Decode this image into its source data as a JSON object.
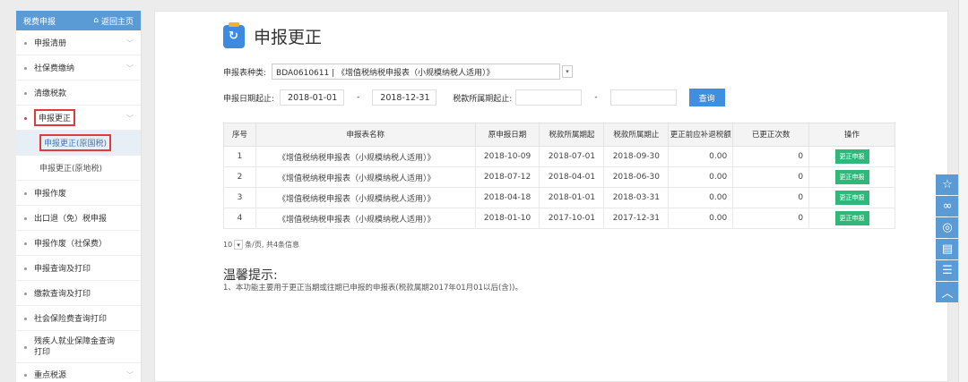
{
  "sidebar": {
    "header_title": "税费申报",
    "home_label": "返回主页",
    "items": [
      {
        "label": "申报清册",
        "chevron": true
      },
      {
        "label": "社保费缴纳",
        "chevron": true
      },
      {
        "label": "清缴税款",
        "chevron": false
      },
      {
        "label": "申报更正",
        "chevron": true,
        "active": true
      },
      {
        "label": "申报作废",
        "chevron": false
      },
      {
        "label": "出口退（免）税申报",
        "chevron": false
      },
      {
        "label": "申报作废（社保费）",
        "chevron": false
      },
      {
        "label": "申报查询及打印",
        "chevron": false
      },
      {
        "label": "缴款查询及打印",
        "chevron": false
      },
      {
        "label": "社会保险费查询打印",
        "chevron": false
      },
      {
        "label": "残疾人就业保障金查询打印",
        "chevron": false
      },
      {
        "label": "重点税源",
        "chevron": true
      }
    ],
    "sub_items": [
      {
        "label": "申报更正(原国税)",
        "selected": true
      },
      {
        "label": "申报更正(原地税)",
        "selected": false
      }
    ]
  },
  "main": {
    "title": "申报更正",
    "form": {
      "type_label": "申报表种类:",
      "type_value": "BDA0610611 | 《增值税纳税申报表（小规模纳税人适用）》",
      "date_label": "申报日期起止:",
      "date_start": "2018-01-01",
      "date_sep": "-",
      "date_end": "2018-12-31",
      "period_label": "税款所属期起止:",
      "period_start": "",
      "period_sep": "-",
      "period_end": "",
      "query_button": "查询"
    },
    "table": {
      "headers": [
        "序号",
        "申报表名称",
        "原申报日期",
        "税款所属期起",
        "税款所属期止",
        "更正前应补退税额",
        "已更正次数",
        "操作"
      ],
      "rows": [
        {
          "no": "1",
          "name": "《增值税纳税申报表（小规模纳税人适用）》",
          "date": "2018-10-09",
          "start": "2018-07-01",
          "end": "2018-09-30",
          "amount": "0.00",
          "count": "0",
          "action": "更正申报"
        },
        {
          "no": "2",
          "name": "《增值税纳税申报表（小规模纳税人适用）》",
          "date": "2018-07-12",
          "start": "2018-04-01",
          "end": "2018-06-30",
          "amount": "0.00",
          "count": "0",
          "action": "更正申报"
        },
        {
          "no": "3",
          "name": "《增值税纳税申报表（小规模纳税人适用）》",
          "date": "2018-04-18",
          "start": "2018-01-01",
          "end": "2018-03-31",
          "amount": "0.00",
          "count": "0",
          "action": "更正申报"
        },
        {
          "no": "4",
          "name": "《增值税纳税申报表（小规模纳税人适用）》",
          "date": "2018-01-10",
          "start": "2017-10-01",
          "end": "2017-12-31",
          "amount": "0.00",
          "count": "0",
          "action": "更正申报"
        }
      ]
    },
    "pager": {
      "page_size": "10",
      "info": "条/页, 共4条信息"
    },
    "tips": {
      "title": "温馨提示:",
      "text": "1、本功能主要用于更正当期或往期已申报的申报表(税款属期2017年01月01以后(含))。"
    }
  },
  "floating_toolbar": [
    "star-icon",
    "link-icon",
    "weibo-icon",
    "message-icon",
    "document-icon",
    "arrow-up-icon"
  ]
}
